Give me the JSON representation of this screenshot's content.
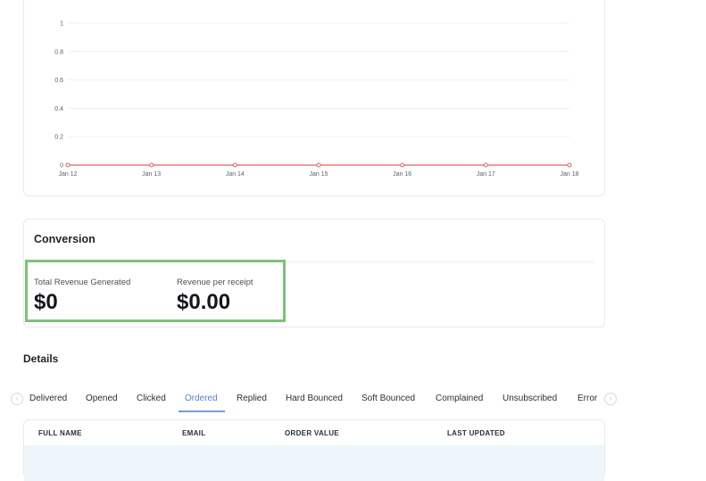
{
  "chart_data": {
    "type": "line",
    "x": [
      "Jan 12",
      "Jan 13",
      "Jan 14",
      "Jan 15",
      "Jan 16",
      "Jan 17",
      "Jan 18"
    ],
    "series": [
      {
        "values": [
          0,
          0,
          0,
          0,
          0,
          0,
          0
        ],
        "color": "#e06060"
      }
    ],
    "yticks": [
      "0",
      "0.2",
      "0.4",
      "0.6",
      "0.8",
      "1"
    ],
    "ylim": [
      0,
      1
    ],
    "grid": true,
    "title": "",
    "xlabel": "",
    "ylabel": ""
  },
  "conversion": {
    "title": "Conversion",
    "metrics": [
      {
        "label": "Total Revenue Generated",
        "value": "$0"
      },
      {
        "label": "Revenue per receipt",
        "value": "$0.00"
      }
    ]
  },
  "details": {
    "title": "Details",
    "tabs": [
      {
        "label": "Delivered"
      },
      {
        "label": "Opened"
      },
      {
        "label": "Clicked"
      },
      {
        "label": "Ordered"
      },
      {
        "label": "Replied"
      },
      {
        "label": "Hard Bounced"
      },
      {
        "label": "Soft Bounced"
      },
      {
        "label": "Complained"
      },
      {
        "label": "Unsubscribed"
      },
      {
        "label": "Error"
      }
    ],
    "active_tab": "Ordered",
    "prev_icon": "chevron-left-icon",
    "next_icon": "chevron-right-icon",
    "table": {
      "columns": [
        "FULL NAME",
        "EMAIL",
        "ORDER VALUE",
        "LAST UPDATED"
      ]
    }
  },
  "colors": {
    "highlight": "#7dc27b",
    "series_line": "#e06060",
    "active_tab": "#5a7fd6"
  }
}
